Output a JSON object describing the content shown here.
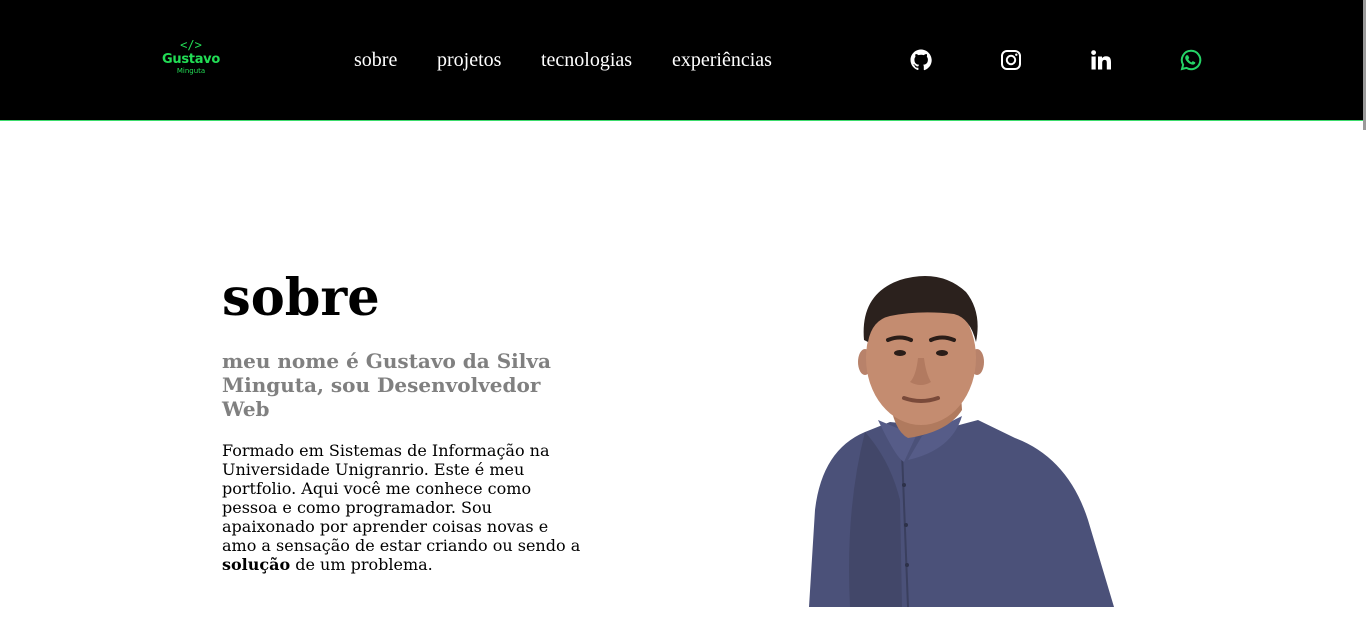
{
  "logo": {
    "code_glyph": "</>",
    "first_name": "Gustavo",
    "last_name": "Minguta",
    "color": "#22dd55"
  },
  "nav": {
    "items": [
      {
        "label": "sobre"
      },
      {
        "label": "projetos"
      },
      {
        "label": "tecnologias"
      },
      {
        "label": "experiências"
      }
    ]
  },
  "social": [
    {
      "icon": "github-icon",
      "color": "#ffffff"
    },
    {
      "icon": "instagram-icon",
      "color": "#ffffff"
    },
    {
      "icon": "linkedin-icon",
      "color": "#ffffff"
    },
    {
      "icon": "whatsapp-icon",
      "color": "#25d366"
    }
  ],
  "about": {
    "title": "sobre",
    "subtitle": "meu nome é Gustavo da Silva Minguta, sou Desenvolvedor Web",
    "bio_before": "Formado em Sistemas de Informação na Universidade Unigranrio. Este é meu portfolio. Aqui você me conhece como pessoa e como programador. Sou apaixonado por aprender coisas novas e amo a sensação de estar criando ou sendo a ",
    "bio_bold": "solução",
    "bio_after": " de um problema."
  },
  "colors": {
    "header_bg": "#000000",
    "accent": "#22dd55",
    "subtitle": "#808080"
  }
}
